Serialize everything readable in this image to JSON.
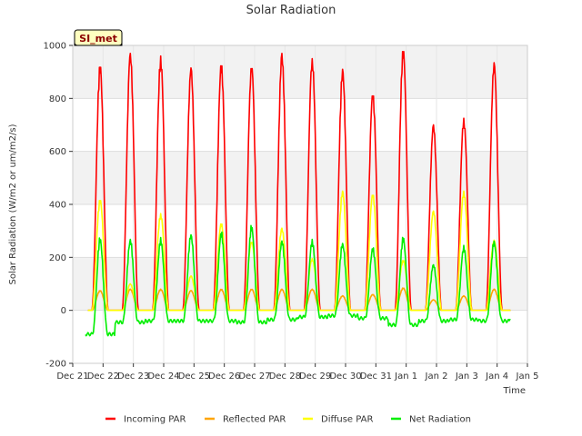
{
  "chart_data": {
    "type": "line",
    "title": "Solar Radiation",
    "xlabel": "Time",
    "ylabel": "Solar Radiation (W/m2 or um/m2/s)",
    "station_label": "SI_met",
    "ylim": [
      -200,
      1000
    ],
    "yticks": [
      -200,
      0,
      200,
      400,
      600,
      800,
      1000
    ],
    "xlim": [
      0,
      15
    ],
    "xticks": [
      {
        "pos": 0,
        "label": "Dec 21"
      },
      {
        "pos": 1,
        "label": "Dec 22"
      },
      {
        "pos": 2,
        "label": "Dec 23"
      },
      {
        "pos": 3,
        "label": "Dec 24"
      },
      {
        "pos": 4,
        "label": "Dec 25"
      },
      {
        "pos": 5,
        "label": "Dec 26"
      },
      {
        "pos": 6,
        "label": "Dec 27"
      },
      {
        "pos": 7,
        "label": "Dec 28"
      },
      {
        "pos": 8,
        "label": "Dec 29"
      },
      {
        "pos": 9,
        "label": "Dec 30"
      },
      {
        "pos": 10,
        "label": "Dec 31"
      },
      {
        "pos": 11,
        "label": "Jan 1"
      },
      {
        "pos": 12,
        "label": "Jan 2"
      },
      {
        "pos": 13,
        "label": "Jan 3"
      },
      {
        "pos": 14,
        "label": "Jan 4"
      },
      {
        "pos": 15,
        "label": "Jan 5"
      }
    ],
    "grid": true,
    "legend_position": "bottom",
    "days": [
      0.9,
      1.9,
      2.9,
      3.9,
      4.9,
      5.9,
      6.9,
      7.9,
      8.9,
      9.9,
      10.9,
      11.9,
      12.9,
      13.9
    ],
    "series": [
      {
        "name": "Incoming PAR",
        "color": "#ff0000",
        "peaks": [
          930,
          970,
          960,
          915,
          935,
          925,
          970,
          950,
          910,
          820,
          990,
          700,
          725,
          935
        ]
      },
      {
        "name": "Reflected PAR",
        "color": "#ffa500",
        "peaks": [
          75,
          80,
          80,
          75,
          80,
          80,
          80,
          80,
          55,
          60,
          85,
          40,
          55,
          80
        ]
      },
      {
        "name": "Diffuse PAR",
        "color": "#ffff00",
        "peaks": [
          420,
          100,
          365,
          130,
          330,
          260,
          310,
          195,
          450,
          440,
          190,
          375,
          450,
          265
        ]
      },
      {
        "name": "Net Radiation",
        "color": "#00ee00",
        "peaks": [
          270,
          260,
          265,
          280,
          290,
          310,
          260,
          255,
          250,
          230,
          270,
          170,
          235,
          255
        ],
        "night_levels": [
          -90,
          -45,
          -40,
          -40,
          -40,
          -45,
          -35,
          -25,
          -20,
          -30,
          -55,
          -40,
          -35,
          -40,
          -30
        ]
      }
    ]
  }
}
